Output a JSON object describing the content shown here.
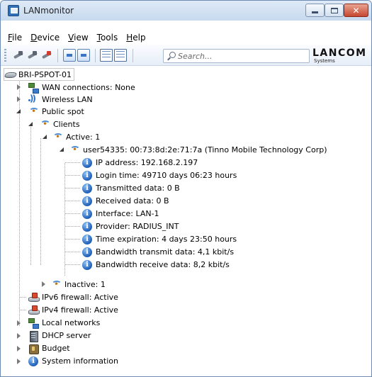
{
  "window": {
    "title": "LANmonitor",
    "controls": {
      "minimize": "minimize",
      "maximize": "maximize",
      "close": "✕"
    }
  },
  "menu": {
    "items": [
      {
        "accel": "F",
        "rest": "ile"
      },
      {
        "accel": "D",
        "rest": "evice"
      },
      {
        "accel": "V",
        "rest": "iew"
      },
      {
        "accel": "T",
        "rest": "ools"
      },
      {
        "accel": "H",
        "rest": "elp"
      }
    ]
  },
  "toolbar": {
    "search_placeholder": "Search...",
    "logo_main": "LANCOM",
    "logo_sub": "Systems"
  },
  "tree": {
    "root": "BRI-PSPOT-01",
    "wan": "WAN connections: None",
    "wireless": "Wireless LAN",
    "public_spot": "Public spot",
    "clients": "Clients",
    "active": "Active: 1",
    "user": "user54335: 00:73:8d:2e:71:7a (Tinno Mobile Technology Corp)",
    "details": [
      "IP address: 192.168.2.197",
      "Login time: 49710 days 06:23 hours",
      "Transmitted data: 0 B",
      "Received data: 0 B",
      "Interface: LAN-1",
      "Provider: RADIUS_INT",
      "Time expiration: 4 days 23:50 hours",
      "Bandwidth transmit data: 4,1 kbit/s",
      "Bandwidth receive data: 8,2 kbit/s"
    ],
    "inactive": "Inactive: 1",
    "ipv6_firewall": "IPv6 firewall: Active",
    "ipv4_firewall": "IPv4 firewall: Active",
    "local_networks": "Local networks",
    "dhcp": "DHCP server",
    "budget": "Budget",
    "sysinfo": "System information"
  }
}
